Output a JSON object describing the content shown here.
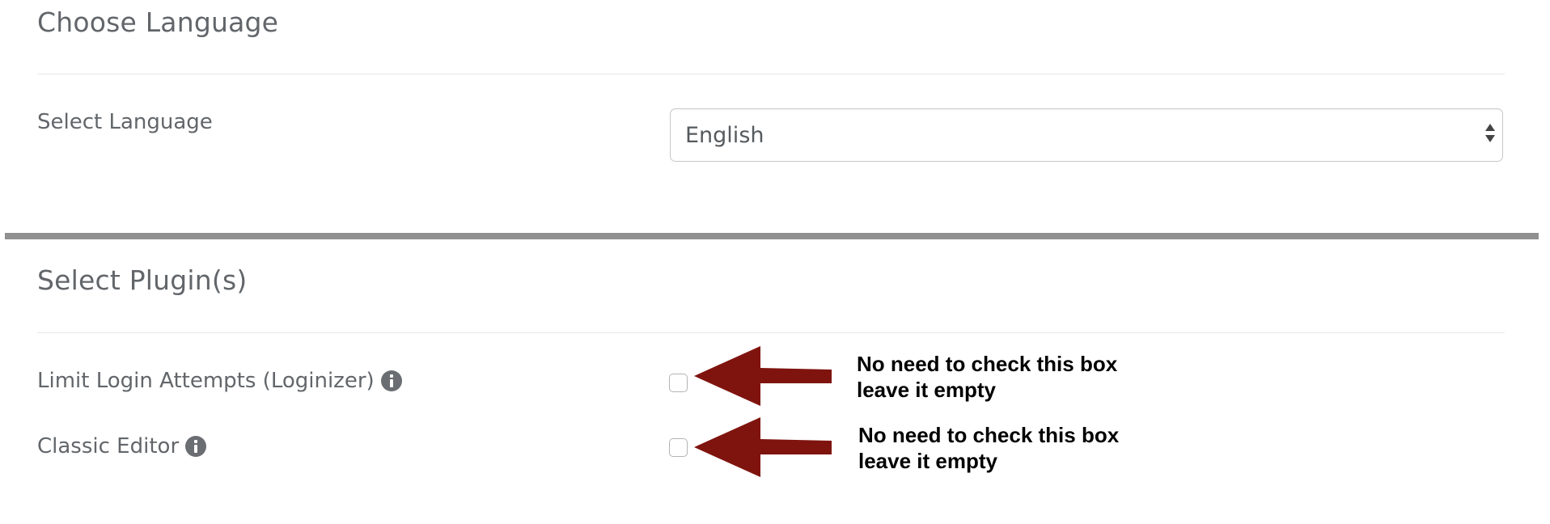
{
  "language_section": {
    "title": "Choose Language",
    "field_label": "Select Language",
    "select": {
      "selected_value": "English"
    }
  },
  "plugins_section": {
    "title": "Select Plugin(s)",
    "plugins": [
      {
        "label": "Limit Login Attempts (Loginizer)",
        "checked": false,
        "info_icon": "info-circle-icon",
        "annotation": {
          "line1": "No need to check this box",
          "line2": "leave it empty"
        }
      },
      {
        "label": "Classic Editor",
        "checked": false,
        "info_icon": "info-circle-icon",
        "annotation": {
          "line1": "No need to check this box",
          "line2": "leave it empty"
        }
      }
    ]
  },
  "colors": {
    "annotation_arrow": "#7f140f",
    "section_divider": "#909090",
    "text": "#62666a"
  }
}
